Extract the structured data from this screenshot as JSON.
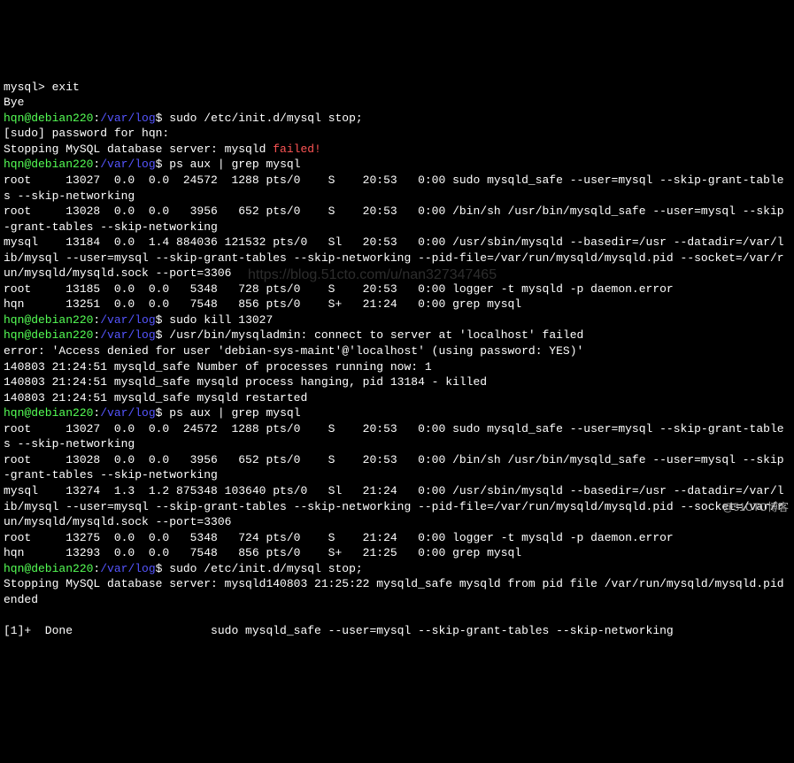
{
  "mysql_prompt": "mysql> ",
  "cmd_exit": "exit",
  "bye": "Bye",
  "prompt": {
    "userhost": "hqn@debian220",
    "sep1": ":",
    "path": "/var/log",
    "sep2": "$ "
  },
  "sudo_stop1": "sudo /etc/init.d/mysql stop;",
  "sudo_pw": "[sudo] password for hqn:",
  "stopping1_a": "Stopping MySQL database server: mysqld ",
  "stopping1_b": "failed!",
  "psaux1": "ps aux | grep mysql",
  "ps_block1_l1": "root     13027  0.0  0.0  24572  1288 pts/0    S    20:53   0:00 sudo mysqld_safe --user=mysql --skip-grant-tables --skip-networking",
  "ps_block1_l2": "root     13028  0.0  0.0   3956   652 pts/0    S    20:53   0:00 /bin/sh /usr/bin/mysqld_safe --user=mysql --skip-grant-tables --skip-networking",
  "ps_block1_l3": "mysql    13184  0.0  1.4 884036 121532 pts/0   Sl   20:53   0:00 /usr/sbin/mysqld --basedir=/usr --datadir=/var/lib/mysql --user=mysql --skip-grant-tables --skip-networking --pid-file=/var/run/mysqld/mysqld.pid --socket=/var/run/mysqld/mysqld.sock --port=3306",
  "ps_block1_l4": "root     13185  0.0  0.0   5348   728 pts/0    S    20:53   0:00 logger -t mysqld -p daemon.error",
  "ps_block1_l5": "hqn      13251  0.0  0.0   7548   856 pts/0    S+   21:24   0:00 grep mysql",
  "kill_cmd": "sudo kill 13027",
  "admin_err": "/usr/bin/mysqladmin: connect to server at 'localhost' failed",
  "err_access": "error: 'Access denied for user 'debian-sys-maint'@'localhost' (using password: YES)'",
  "safe_num": "140803 21:24:51 mysqld_safe Number of processes running now: 1",
  "safe_hang": "140803 21:24:51 mysqld_safe mysqld process hanging, pid 13184 - killed",
  "safe_restart": "140803 21:24:51 mysqld_safe mysqld restarted",
  "psaux2": "ps aux | grep mysql",
  "ps_block2_l1": "root     13027  0.0  0.0  24572  1288 pts/0    S    20:53   0:00 sudo mysqld_safe --user=mysql --skip-grant-tables --skip-networking",
  "ps_block2_l2": "root     13028  0.0  0.0   3956   652 pts/0    S    20:53   0:00 /bin/sh /usr/bin/mysqld_safe --user=mysql --skip-grant-tables --skip-networking",
  "ps_block2_l3": "mysql    13274  1.3  1.2 875348 103640 pts/0   Sl   21:24   0:00 /usr/sbin/mysqld --basedir=/usr --datadir=/var/lib/mysql --user=mysql --skip-grant-tables --skip-networking --pid-file=/var/run/mysqld/mysqld.pid --socket=/var/run/mysqld/mysqld.sock --port=3306",
  "ps_block2_l4": "root     13275  0.0  0.0   5348   724 pts/0    S    21:24   0:00 logger -t mysqld -p daemon.error",
  "ps_block2_l5": "hqn      13293  0.0  0.0   7548   856 pts/0    S+   21:25   0:00 grep mysql",
  "sudo_stop2": "sudo /etc/init.d/mysql stop;",
  "stopping2": "Stopping MySQL database server: mysqld140803 21:25:22 mysqld_safe mysqld from pid file /var/run/mysqld/mysqld.pid ended",
  "blank": "",
  "done_line": "[1]+  Done                    sudo mysqld_safe --user=mysql --skip-grant-tables --skip-networking",
  "watermark_text": "https://blog.51cto.com/u/nan327347465",
  "footer_text": "@51CTO博客"
}
